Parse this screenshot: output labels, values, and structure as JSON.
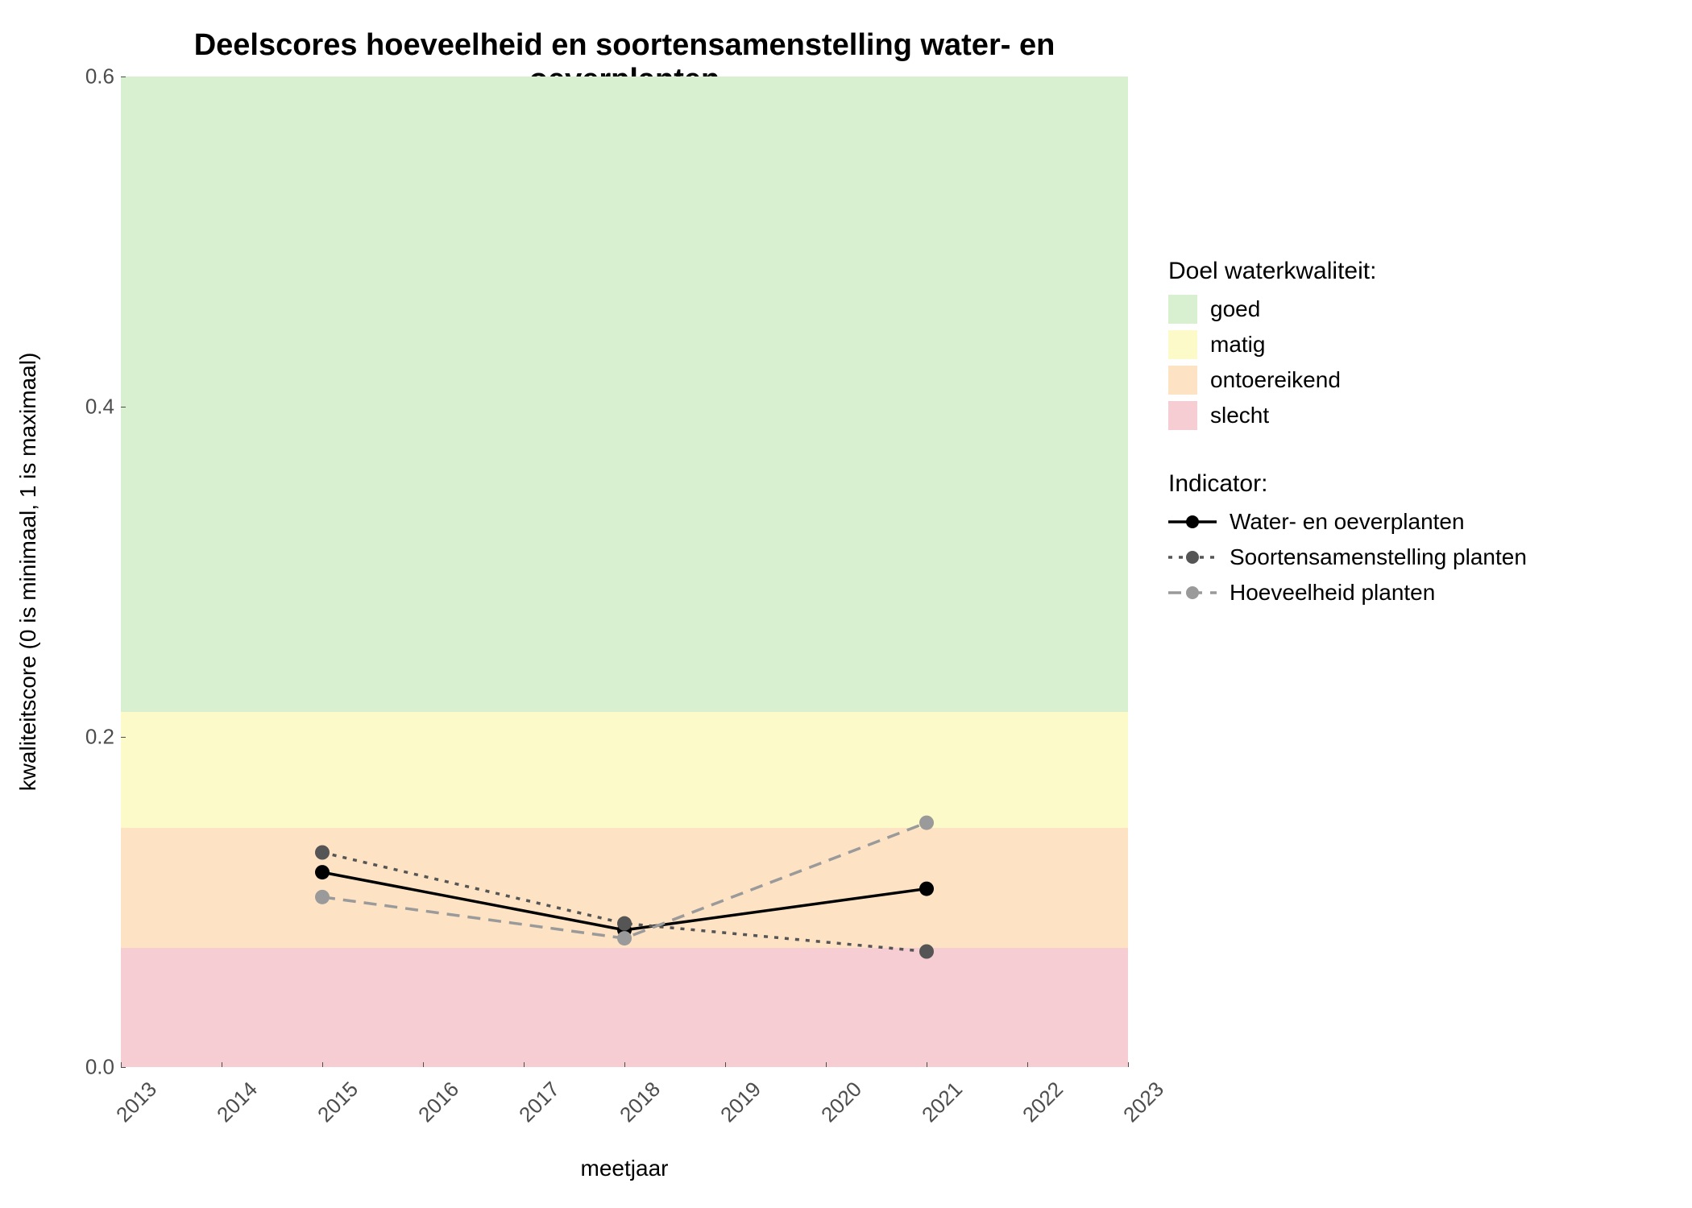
{
  "chart_data": {
    "type": "line",
    "title": "Deelscores hoeveelheid en soortensamenstelling water- en oeverplanten",
    "xlabel": "meetjaar",
    "ylabel": "kwaliteitscore (0 is minimaal, 1 is maximaal)",
    "xlim": [
      2013,
      2023
    ],
    "ylim": [
      0,
      0.6
    ],
    "x_ticks": [
      2013,
      2014,
      2015,
      2016,
      2017,
      2018,
      2019,
      2020,
      2021,
      2022,
      2023
    ],
    "y_ticks": [
      0.0,
      0.2,
      0.4,
      0.6
    ],
    "bands": [
      {
        "name": "slecht",
        "ymin": 0.0,
        "ymax": 0.072,
        "color": "#f7cdd4"
      },
      {
        "name": "ontoereikend",
        "ymin": 0.072,
        "ymax": 0.145,
        "color": "#fde3c4"
      },
      {
        "name": "matig",
        "ymin": 0.145,
        "ymax": 0.215,
        "color": "#fdfac9"
      },
      {
        "name": "goed",
        "ymin": 0.215,
        "ymax": 0.6,
        "color": "#d9f0d0"
      }
    ],
    "series": [
      {
        "name": "Water- en oeverplanten",
        "color": "#000000",
        "dash": "solid",
        "x": [
          2015,
          2018,
          2021
        ],
        "y": [
          0.118,
          0.083,
          0.108
        ]
      },
      {
        "name": "Soortensamenstelling planten",
        "color": "#555555",
        "dash": "dotted",
        "x": [
          2015,
          2018,
          2021
        ],
        "y": [
          0.13,
          0.087,
          0.07
        ]
      },
      {
        "name": "Hoeveelheid planten",
        "color": "#9a9a9a",
        "dash": "dashed",
        "x": [
          2015,
          2018,
          2021
        ],
        "y": [
          0.103,
          0.078,
          0.148
        ]
      }
    ],
    "legend_fill_title": "Doel waterkwaliteit:",
    "legend_fill_items": [
      "goed",
      "matig",
      "ontoereikend",
      "slecht"
    ],
    "legend_line_title": "Indicator:",
    "legend_line_items": [
      "Water- en oeverplanten",
      "Soortensamenstelling planten",
      "Hoeveelheid planten"
    ]
  }
}
